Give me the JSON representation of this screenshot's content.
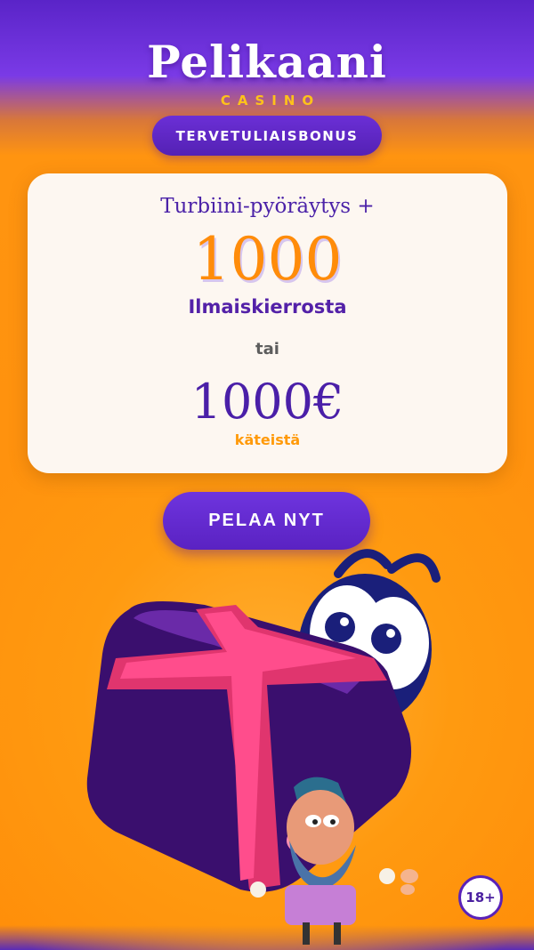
{
  "brand": {
    "title": "Pelikaani",
    "subtitle": "CASINO"
  },
  "header": {
    "welcome_label": "TERVETULIAISBONUS"
  },
  "offer": {
    "intro": "Turbiini-pyöräytys +",
    "spins_amount": "1000",
    "spins_label": "Ilmaiskierrosta",
    "or_text": "tai",
    "cash_amount": "1000€",
    "cash_label": "käteistä"
  },
  "cta": {
    "play_label": "PELAA NYT"
  },
  "badge": {
    "age_label": "18+"
  },
  "colors": {
    "brand_purple": "#5a22c2",
    "accent_orange": "#ff8c0a",
    "accent_yellow": "#ffc21a",
    "card_background": "#fdf7f1"
  },
  "illustration": {
    "icons": [
      "gift-box-icon",
      "mascot-eyes-icon",
      "bearded-pirate-character-icon"
    ]
  }
}
